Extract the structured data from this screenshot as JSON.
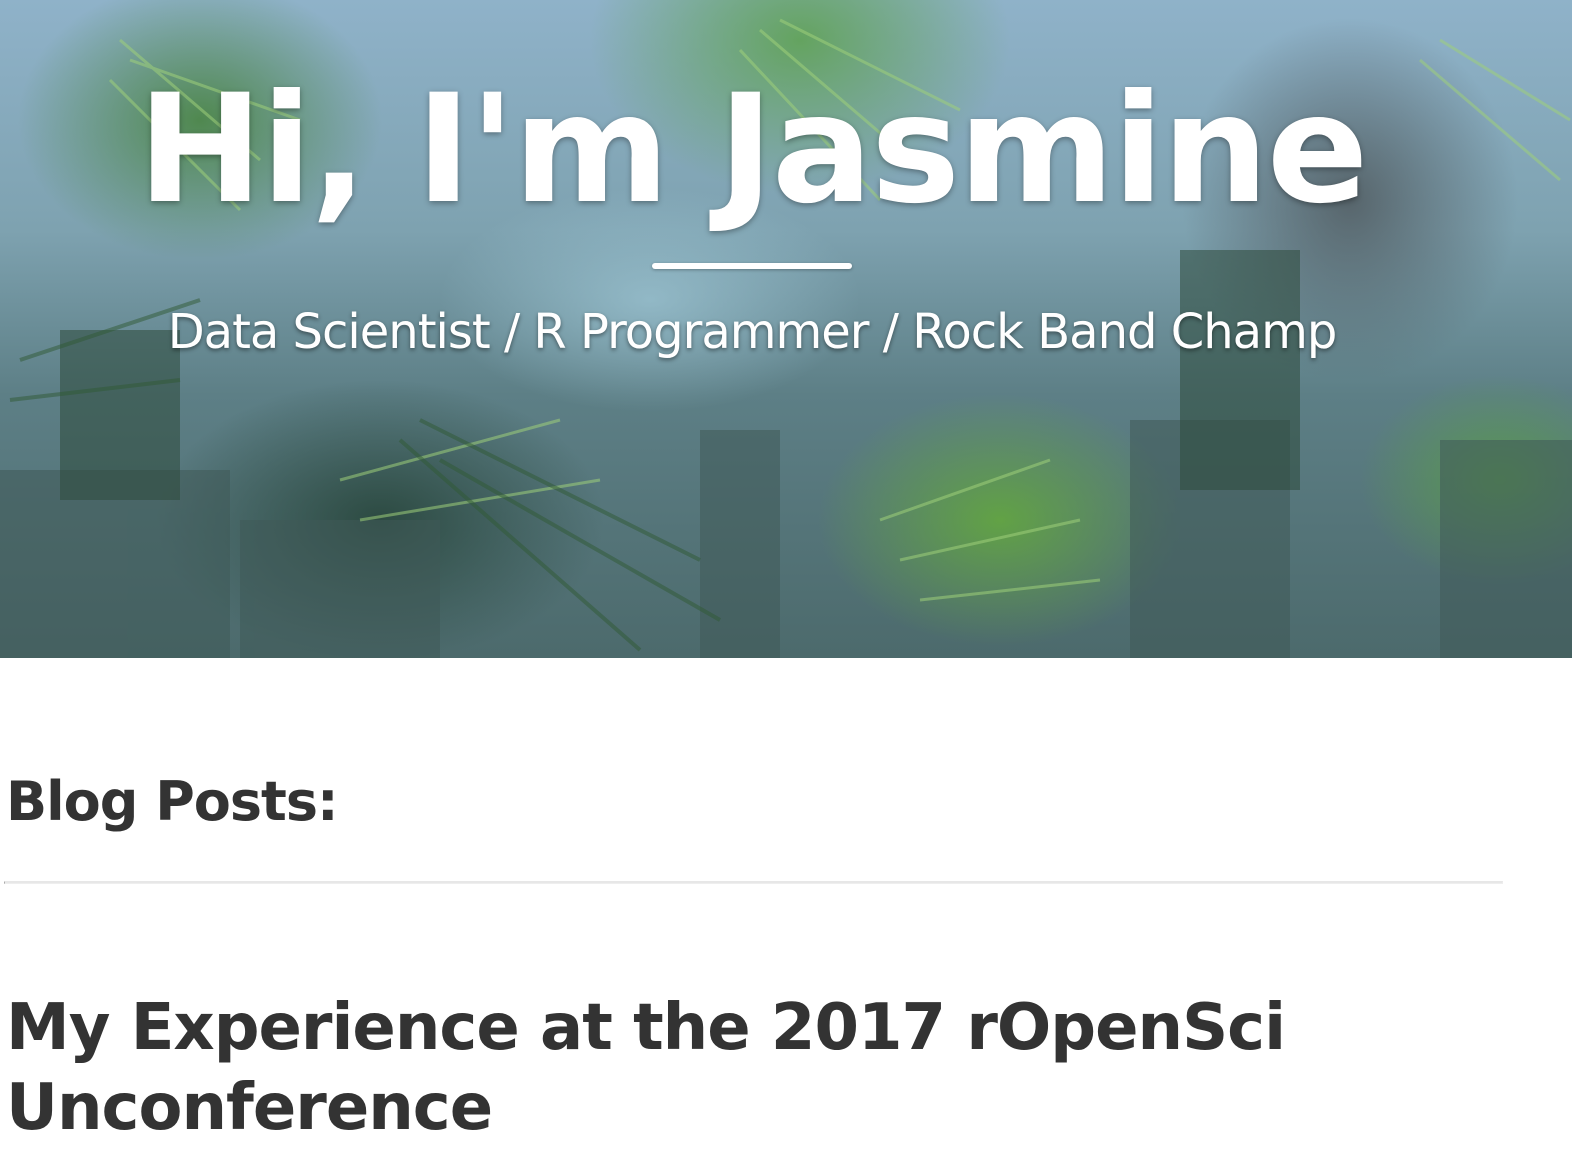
{
  "header": {
    "title": "Hi, I'm Jasmine",
    "subtitle": "Data Scientist / R Programmer / Rock Band Champ"
  },
  "main": {
    "section_heading": "Blog Posts:",
    "posts": [
      {
        "title": "My Experience at the 2017 rOpenSci Unconference"
      }
    ]
  },
  "colors": {
    "heading_text": "#333333",
    "hero_text": "#ffffff",
    "rule": "#e7e7e7"
  }
}
